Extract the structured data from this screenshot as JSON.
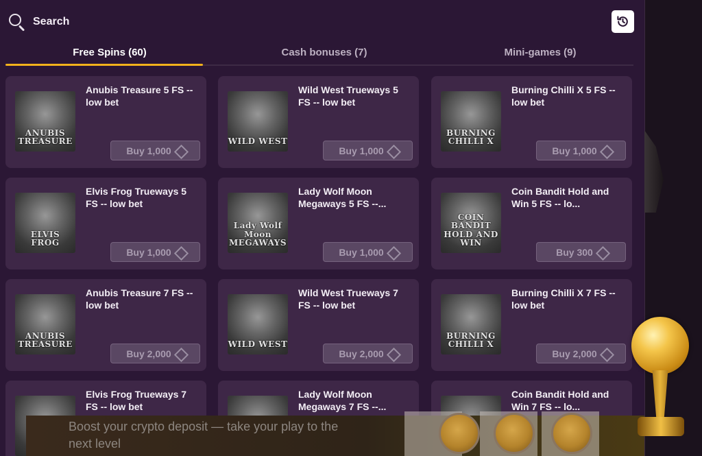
{
  "search": {
    "label": "Search"
  },
  "history_button": {
    "icon": "history-icon"
  },
  "tabs": [
    {
      "label": "Free Spins (60)",
      "active": true
    },
    {
      "label": "Cash bonuses (7)",
      "active": false
    },
    {
      "label": "Mini-games (9)",
      "active": false
    }
  ],
  "cards": [
    {
      "title": "Anubis Treasure 5 FS -- low bet",
      "buy": "Buy 1,000",
      "logo": "ANUBIS TREASURE"
    },
    {
      "title": "Wild West Trueways 5 FS -- low bet",
      "buy": "Buy 1,000",
      "logo": "WILD WEST"
    },
    {
      "title": "Burning Chilli X 5 FS -- low bet",
      "buy": "Buy 1,000",
      "logo": "BURNING CHILLI X"
    },
    {
      "title": "Elvis Frog Trueways 5 FS -- low bet",
      "buy": "Buy 1,000",
      "logo": "ELVIS FROG"
    },
    {
      "title": "Lady Wolf Moon Megaways 5 FS --...",
      "buy": "Buy 1,000",
      "logo": "Lady Wolf Moon MEGAWAYS"
    },
    {
      "title": "Coin Bandit Hold and Win 5 FS -- lo...",
      "buy": "Buy 300",
      "logo": "COIN BANDIT HOLD AND WIN"
    },
    {
      "title": "Anubis Treasure 7 FS -- low bet",
      "buy": "Buy 2,000",
      "logo": "ANUBIS TREASURE"
    },
    {
      "title": "Wild West Trueways 7 FS -- low bet",
      "buy": "Buy 2,000",
      "logo": "WILD WEST"
    },
    {
      "title": "Burning Chilli X 7 FS -- low bet",
      "buy": "Buy 2,000",
      "logo": "BURNING CHILLI X"
    },
    {
      "title": "Elvis Frog Trueways 7 FS -- low bet",
      "buy": "",
      "logo": ""
    },
    {
      "title": "Lady Wolf Moon Megaways 7 FS --...",
      "buy": "",
      "logo": ""
    },
    {
      "title": "Coin Bandit Hold and Win 7 FS -- lo...",
      "buy": "",
      "logo": ""
    }
  ],
  "banner": {
    "text": "Boost your crypto deposit — take your play to the next level"
  },
  "colors": {
    "panel_bg": "#2b1735",
    "card_bg": "#3e2747",
    "accent": "#f2b21c",
    "trophy": "#f4c54a"
  }
}
